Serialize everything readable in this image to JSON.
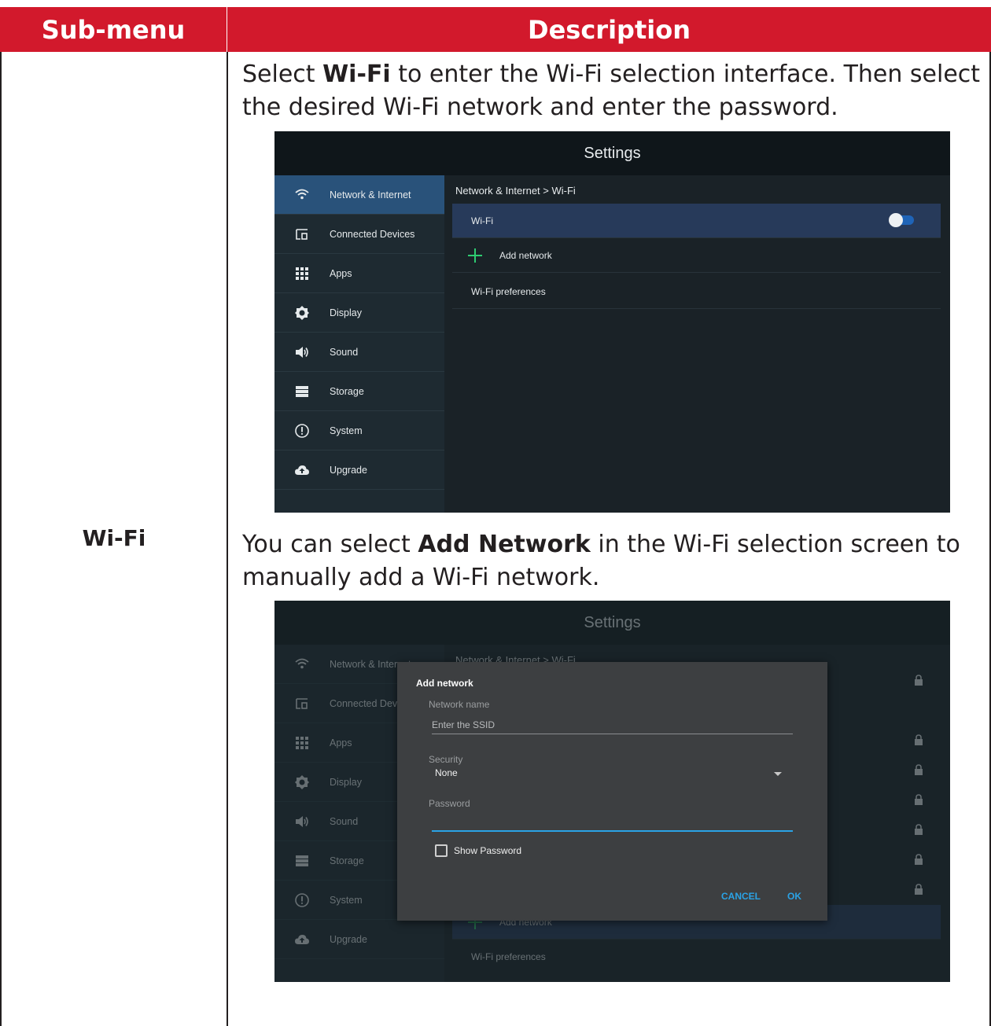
{
  "table": {
    "col_submenu": "Sub-menu",
    "col_description": "Description",
    "submenu_label": "Wi-Fi",
    "desc1": {
      "pre": "Select ",
      "bold": "Wi-Fi",
      "post": " to enter the Wi-Fi selection interface. Then select the desired Wi-Fi network and enter the password."
    },
    "desc2": {
      "pre": "You can select ",
      "bold": "Add Network",
      "post": " in the Wi-Fi selection screen to manually add a Wi-Fi network."
    }
  },
  "settings": {
    "title": "Settings",
    "sidebar": [
      {
        "label": "Network & Internet",
        "icon": "wifi-icon"
      },
      {
        "label": "Connected Devices",
        "icon": "devices-icon"
      },
      {
        "label": "Apps",
        "icon": "apps-grid-icon"
      },
      {
        "label": "Display",
        "icon": "brightness-icon"
      },
      {
        "label": "Sound",
        "icon": "speaker-icon"
      },
      {
        "label": "Storage",
        "icon": "storage-icon"
      },
      {
        "label": "System",
        "icon": "info-icon"
      },
      {
        "label": "Upgrade",
        "icon": "cloud-upload-icon"
      }
    ],
    "breadcrumb": "Network & Internet > Wi-Fi",
    "wifi_row": "Wi-Fi",
    "wifi_enabled": true,
    "add_network": "Add network",
    "wifi_preferences": "Wi-Fi preferences"
  },
  "settings2": {
    "title": "Settings",
    "sidebar": [
      "Network & Internet",
      "Connected Devices",
      "Apps",
      "Display",
      "Sound",
      "Storage",
      "System",
      "Upgrade"
    ],
    "breadcrumb": "Network & Internet > Wi-Fi",
    "add_network": "Add network",
    "wifi_preferences": "Wi-Fi preferences"
  },
  "dialog": {
    "title": "Add network",
    "network_name_label": "Network name",
    "network_name_placeholder": "Enter the SSID",
    "security_label": "Security",
    "security_value": "None",
    "password_label": "Password",
    "password_value": "",
    "show_password_label": "Show Password",
    "show_password_checked": false,
    "cancel_label": "CANCEL",
    "ok_label": "OK"
  },
  "colors": {
    "header_red": "#d2192c",
    "active_blue": "#29527a",
    "accent_blue": "#2aa3e6",
    "plus_green": "#2ecc71"
  }
}
